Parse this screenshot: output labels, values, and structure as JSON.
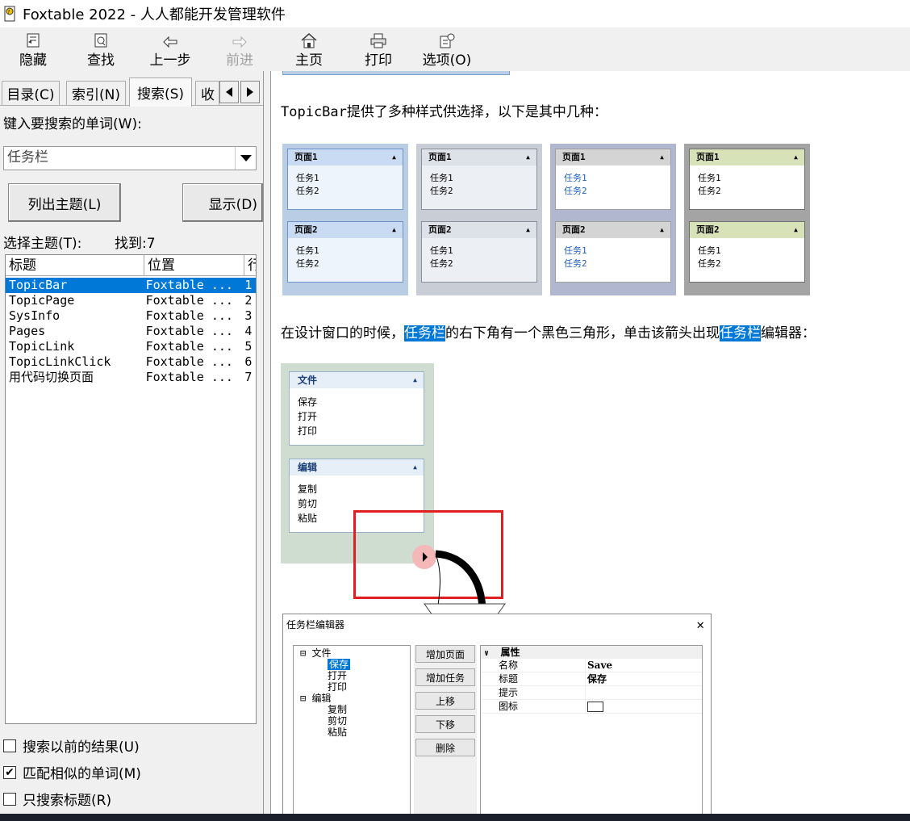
{
  "window": {
    "title": "Foxtable 2022 - 人人都能开发管理软件"
  },
  "toolbar": {
    "hide": "隐藏",
    "find": "查找",
    "back": "上一步",
    "forward": "前进",
    "home": "主页",
    "print": "打印",
    "options": "选项(O)"
  },
  "tabs": {
    "contents": "目录(C)",
    "index": "索引(N)",
    "search": "搜索(S)",
    "favorites": "收"
  },
  "search": {
    "prompt": "键入要搜索的单词(W):",
    "query": "任务栏",
    "list_button": "列出主题(L)",
    "display_button": "显示(D)",
    "select_label": "选择主题(T):",
    "found_label": "找到:7",
    "columns": [
      "标题",
      "位置",
      "行"
    ],
    "results": [
      {
        "title": "TopicBar",
        "location": "Foxtable ...",
        "rank": "1"
      },
      {
        "title": "TopicPage",
        "location": "Foxtable ...",
        "rank": "2"
      },
      {
        "title": "SysInfo",
        "location": "Foxtable ...",
        "rank": "3"
      },
      {
        "title": "Pages",
        "location": "Foxtable ...",
        "rank": "4"
      },
      {
        "title": "TopicLink",
        "location": "Foxtable ...",
        "rank": "5"
      },
      {
        "title": "TopicLinkClick",
        "location": "Foxtable ...",
        "rank": "6"
      },
      {
        "title": "用代码切换页面",
        "location": "Foxtable ...",
        "rank": "7"
      }
    ],
    "options": [
      {
        "label": "搜索以前的结果(U)",
        "checked": false
      },
      {
        "label": "匹配相似的单词(M)",
        "checked": true
      },
      {
        "label": "只搜索标题(R)",
        "checked": false
      }
    ]
  },
  "content": {
    "para1": "TopicBar提供了多种样式供选择，以下是其中几种：",
    "para2_a": "在设计窗口的时候，",
    "para2_hl1": "任务栏",
    "para2_b": "的右下角有一个黑色三角形，单击该箭头出现",
    "para2_hl2": "任务栏",
    "para2_c": "编辑器：",
    "styles": [
      {
        "p1": "页面1",
        "p2": "页面2",
        "t1": "任务1",
        "t2": "任务2",
        "bg": "#b9cde5",
        "hdr": "#c9dbf2",
        "body": "#eef4fb",
        "border": "#6f93c9",
        "tcolor": "#000"
      },
      {
        "p1": "页面1",
        "p2": "页面2",
        "t1": "任务1",
        "t2": "任务2",
        "bg": "#c8cdd6",
        "hdr": "#dde1e8",
        "body": "#eceff3",
        "border": "#8a909c",
        "tcolor": "#000"
      },
      {
        "p1": "页面1",
        "p2": "页面2",
        "t1": "任务1",
        "t2": "任务2",
        "bg": "#b0b7cf",
        "hdr": "#d4d4d4",
        "body": "#ffffff",
        "border": "#a0a0a0",
        "tcolor": "#1f5fbf"
      },
      {
        "p1": "页面1",
        "p2": "页面2",
        "t1": "任务1",
        "t2": "任务2",
        "bg": "#a4a4a4",
        "hdr": "#d7e2b8",
        "body": "#ffffff",
        "border": "#6e6e6e",
        "tcolor": "#000"
      }
    ],
    "demo": {
      "p1": "文件",
      "p1_items": [
        "保存",
        "打开",
        "打印"
      ],
      "p2": "编辑",
      "p2_items": [
        "复制",
        "剪切",
        "粘贴"
      ]
    },
    "editor": {
      "title": "任务栏编辑器",
      "tree": [
        {
          "label": "文件",
          "level": 0
        },
        {
          "label": "保存",
          "level": 1,
          "selected": true
        },
        {
          "label": "打开",
          "level": 1
        },
        {
          "label": "打印",
          "level": 1
        },
        {
          "label": "编辑",
          "level": 0
        },
        {
          "label": "复制",
          "level": 1
        },
        {
          "label": "剪切",
          "level": 1
        },
        {
          "label": "粘贴",
          "level": 1
        }
      ],
      "buttons": [
        "增加页面",
        "增加任务",
        "上移",
        "下移",
        "删除"
      ],
      "props_header": "属性",
      "props": [
        {
          "name": "名称",
          "value": "Save"
        },
        {
          "name": "标题",
          "value": "保存"
        },
        {
          "name": "提示",
          "value": ""
        },
        {
          "name": "图标",
          "value": ""
        }
      ]
    }
  }
}
